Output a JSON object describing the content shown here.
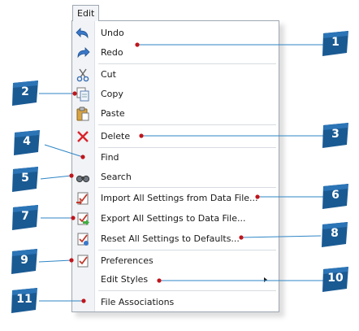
{
  "menu": {
    "title": "Edit",
    "items": [
      {
        "label": "Undo",
        "icon": "undo-icon"
      },
      {
        "label": "Redo",
        "icon": "redo-icon"
      },
      {
        "label": "Cut",
        "icon": "scissors-icon"
      },
      {
        "label": "Copy",
        "icon": "copy-icon"
      },
      {
        "label": "Paste",
        "icon": "paste-icon"
      },
      {
        "label": "Delete",
        "icon": "delete-x-icon"
      },
      {
        "label": "Find",
        "icon": ""
      },
      {
        "label": "Search",
        "icon": "binoculars-icon"
      },
      {
        "label": "Import All Settings from Data File...",
        "icon": "import-settings-icon"
      },
      {
        "label": "Export All Settings to Data File...",
        "icon": "export-settings-icon"
      },
      {
        "label": "Reset All Settings to Defaults...",
        "icon": "reset-settings-icon"
      },
      {
        "label": "Preferences",
        "icon": "preferences-icon"
      },
      {
        "label": "Edit Styles",
        "icon": "",
        "submenu": true
      },
      {
        "label": "File Associations",
        "icon": ""
      }
    ]
  },
  "callouts": [
    "1",
    "2",
    "3",
    "4",
    "5",
    "6",
    "7",
    "8",
    "9",
    "10",
    "11"
  ],
  "colors": {
    "callout_fill": "#1a5a93",
    "callout_line": "#2f86c6",
    "callout_dot": "#c0151b",
    "delete_red": "#d9232b"
  }
}
